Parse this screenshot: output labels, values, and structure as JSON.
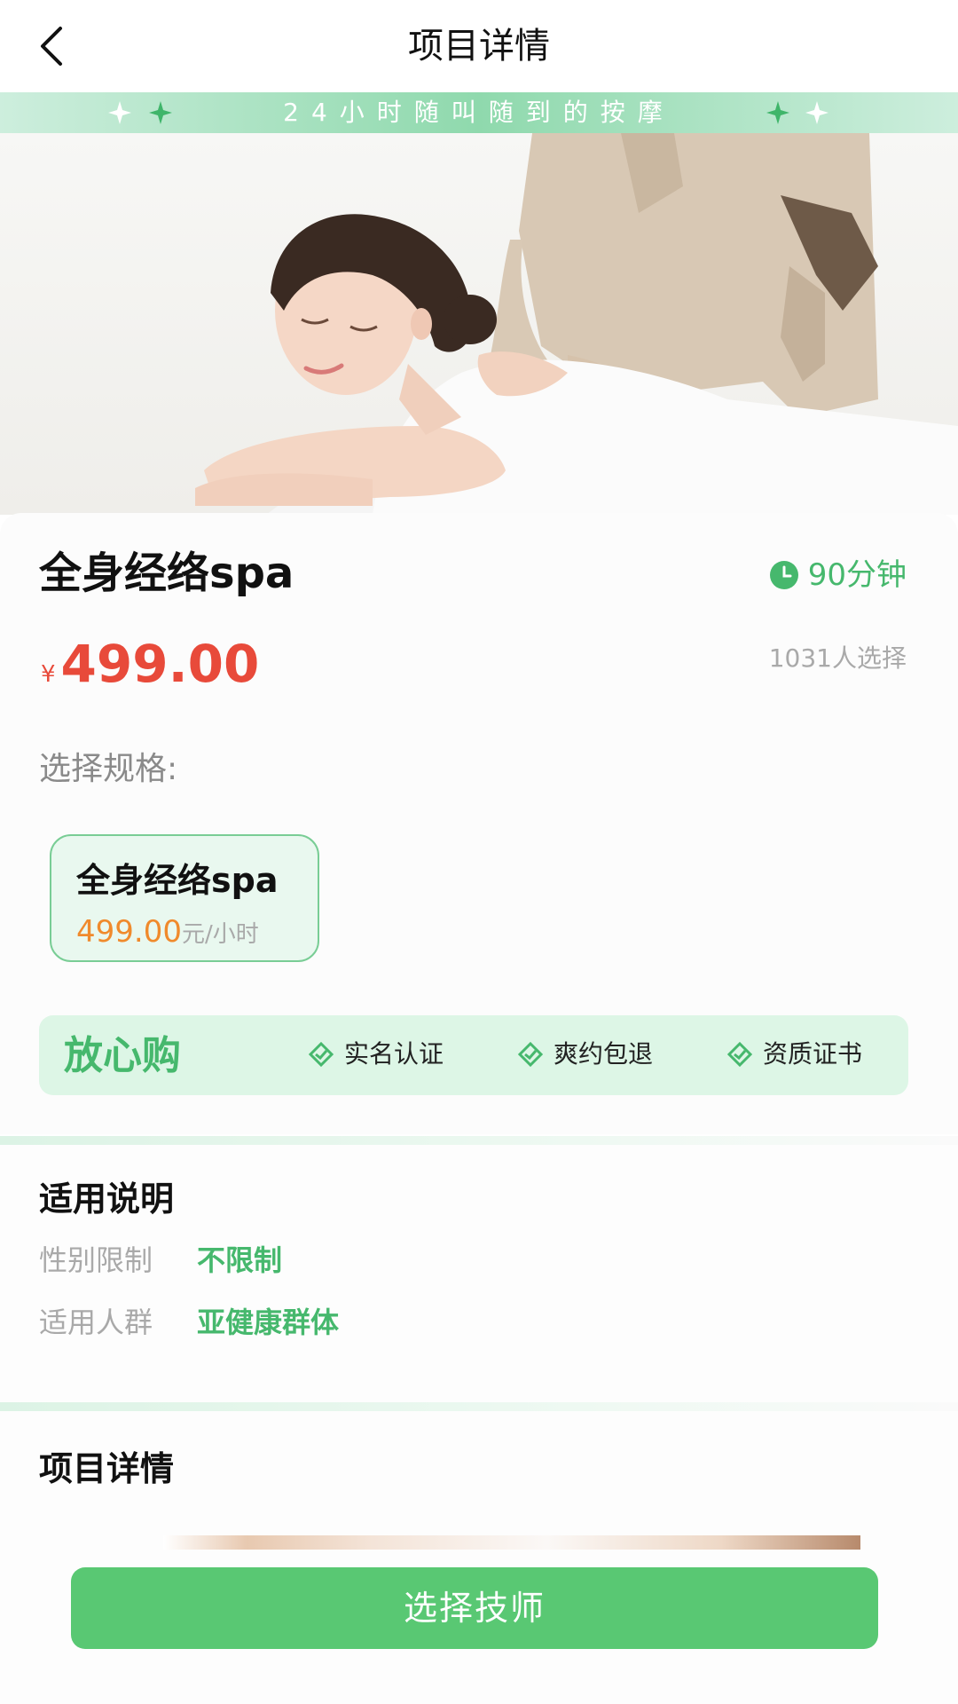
{
  "header": {
    "title": "项目详情"
  },
  "banner": {
    "text": "24小时随叫随到的按摩"
  },
  "product": {
    "name": "全身经络spa",
    "duration": "90分钟",
    "currency": "¥",
    "price": "499.00",
    "chosen_count": "1031人选择"
  },
  "spec": {
    "label": "选择规格:",
    "options": [
      {
        "name": "全身经络spa",
        "price": "499.00",
        "unit": "元/小时"
      }
    ]
  },
  "assurance": {
    "title": "放心购",
    "items": [
      "实名认证",
      "爽约包退",
      "资质证书"
    ]
  },
  "applicable": {
    "title": "适用说明",
    "rows": [
      {
        "label": "性别限制",
        "value": "不限制"
      },
      {
        "label": "适用人群",
        "value": "亚健康群体"
      }
    ]
  },
  "details": {
    "title": "项目详情"
  },
  "cta": {
    "label": "选择技师"
  },
  "colors": {
    "accent": "#59c873",
    "accent_text": "#46b86d",
    "price": "#e84a3a",
    "spec_price": "#f08a2c"
  },
  "icons": {
    "back": "chevron-left-icon",
    "clock": "clock-icon",
    "check": "diamond-check-icon",
    "sparkle": "sparkle-icon"
  }
}
